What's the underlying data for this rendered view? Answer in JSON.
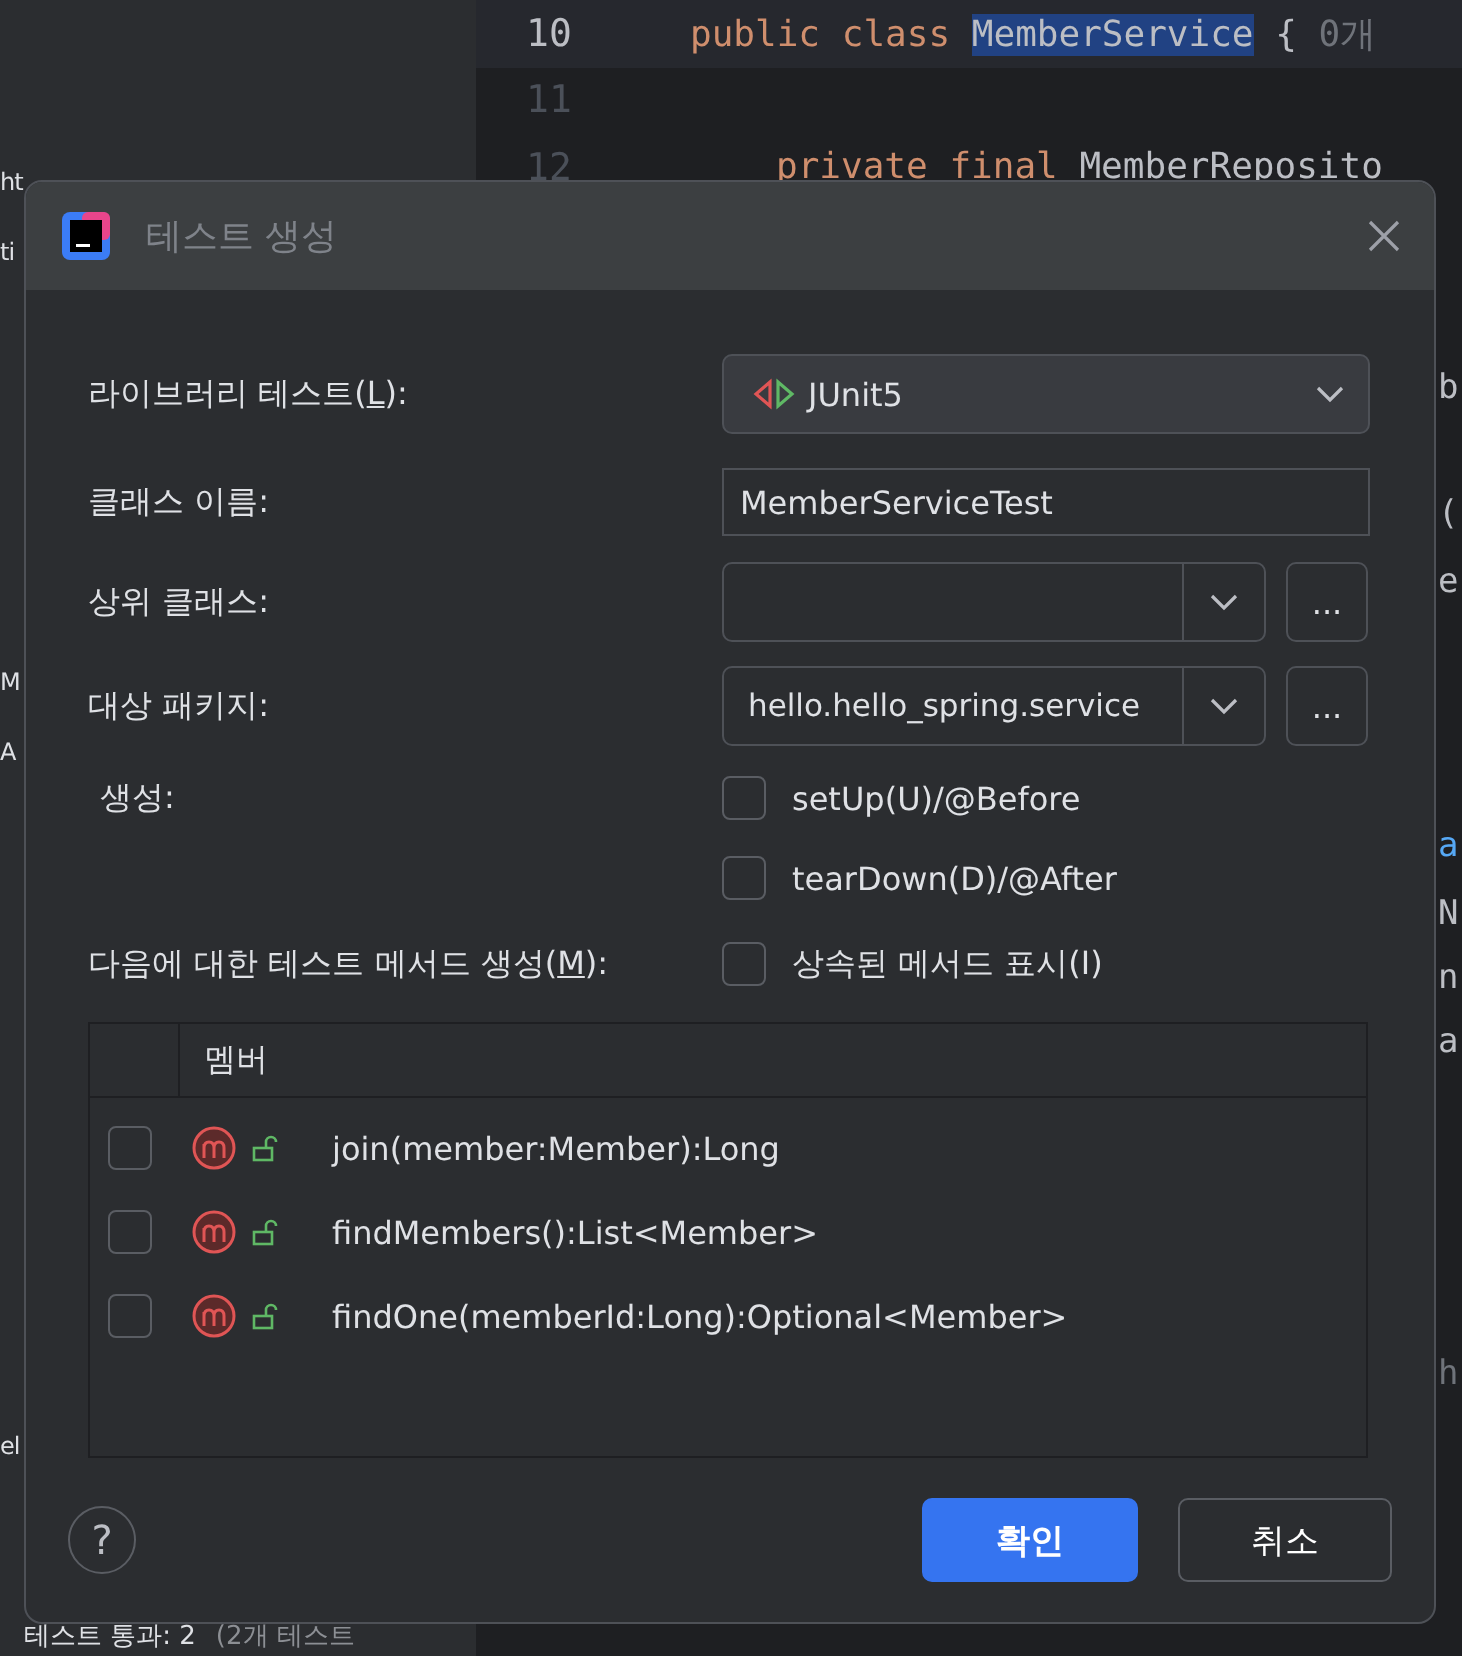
{
  "ide": {
    "left_fragments": [
      {
        "text": "ht"
      },
      {
        "text": "ti"
      },
      {
        "text": "M"
      },
      {
        "text": "A"
      },
      {
        "text": "el"
      }
    ],
    "editor": {
      "lines": [
        {
          "number": "10",
          "current": true,
          "tokens": [
            {
              "kind": "keyword",
              "text": "public class "
            },
            {
              "kind": "selected",
              "text": "MemberService"
            },
            {
              "kind": "plain",
              "text": " { "
            },
            {
              "kind": "hint",
              "text": "0개"
            }
          ]
        },
        {
          "number": "11",
          "current": false
        },
        {
          "number": "12",
          "current": false,
          "kind": "member",
          "tokens": [
            {
              "kind": "keyword",
              "text": "private final "
            },
            {
              "kind": "plain",
              "text": "MemberReposito"
            }
          ]
        }
      ]
    },
    "right_fragments": [
      {
        "text": "b",
        "kind": "plain"
      },
      {
        "text": "(",
        "kind": "plain"
      },
      {
        "text": "e",
        "kind": "plain"
      },
      {
        "text": "a",
        "kind": "link"
      },
      {
        "text": "N",
        "kind": "plain"
      },
      {
        "text": "n",
        "kind": "plain"
      },
      {
        "text": "a",
        "kind": "plain"
      },
      {
        "text": "h",
        "kind": "hint"
      }
    ],
    "status": {
      "label": "테스트 통과: 2",
      "detail": "(2개 테스트"
    }
  },
  "dialog": {
    "title": "테스트 생성",
    "fields": [
      {
        "kind": "dropdown",
        "label": [
          {
            "text": "라이브러리 테스트("
          },
          {
            "text": "L",
            "mnemonic": true
          },
          {
            "text": "):"
          }
        ],
        "value": "JUnit5"
      },
      {
        "kind": "input",
        "label": [
          {
            "text": "클래스 이름:"
          }
        ],
        "value": "MemberServiceTest"
      },
      {
        "kind": "combo",
        "label": [
          {
            "text": "상위 클래스:"
          }
        ],
        "browse": "..."
      },
      {
        "kind": "combo",
        "label": [
          {
            "text": "대상 패키지:"
          }
        ],
        "value": "hello.hello_spring.service",
        "browse": "..."
      }
    ],
    "generate": {
      "label": "생성:",
      "options": [
        {
          "label": "setUp(U)/@Before",
          "checked": false
        },
        {
          "label": "tearDown(D)/@After",
          "checked": false
        }
      ]
    },
    "methods_label": [
      {
        "text": "다음에 대한 테스트 메서드 생성("
      },
      {
        "text": "M",
        "mnemonic": true
      },
      {
        "text": "):"
      }
    ],
    "show_inherited": {
      "label": "상속된 메서드 표시(I)",
      "checked": false
    },
    "table": {
      "column": "멤버",
      "rows": [
        {
          "signature": "join(member:Member):Long",
          "checked": false
        },
        {
          "signature": "findMembers():List<Member>",
          "checked": false
        },
        {
          "signature": "findOne(memberId:Long):Optional<Member>",
          "checked": false
        }
      ]
    },
    "buttons": [
      {
        "label": "확인",
        "kind": "primary"
      },
      {
        "label": "취소",
        "kind": "secondary"
      }
    ],
    "help": "?"
  }
}
